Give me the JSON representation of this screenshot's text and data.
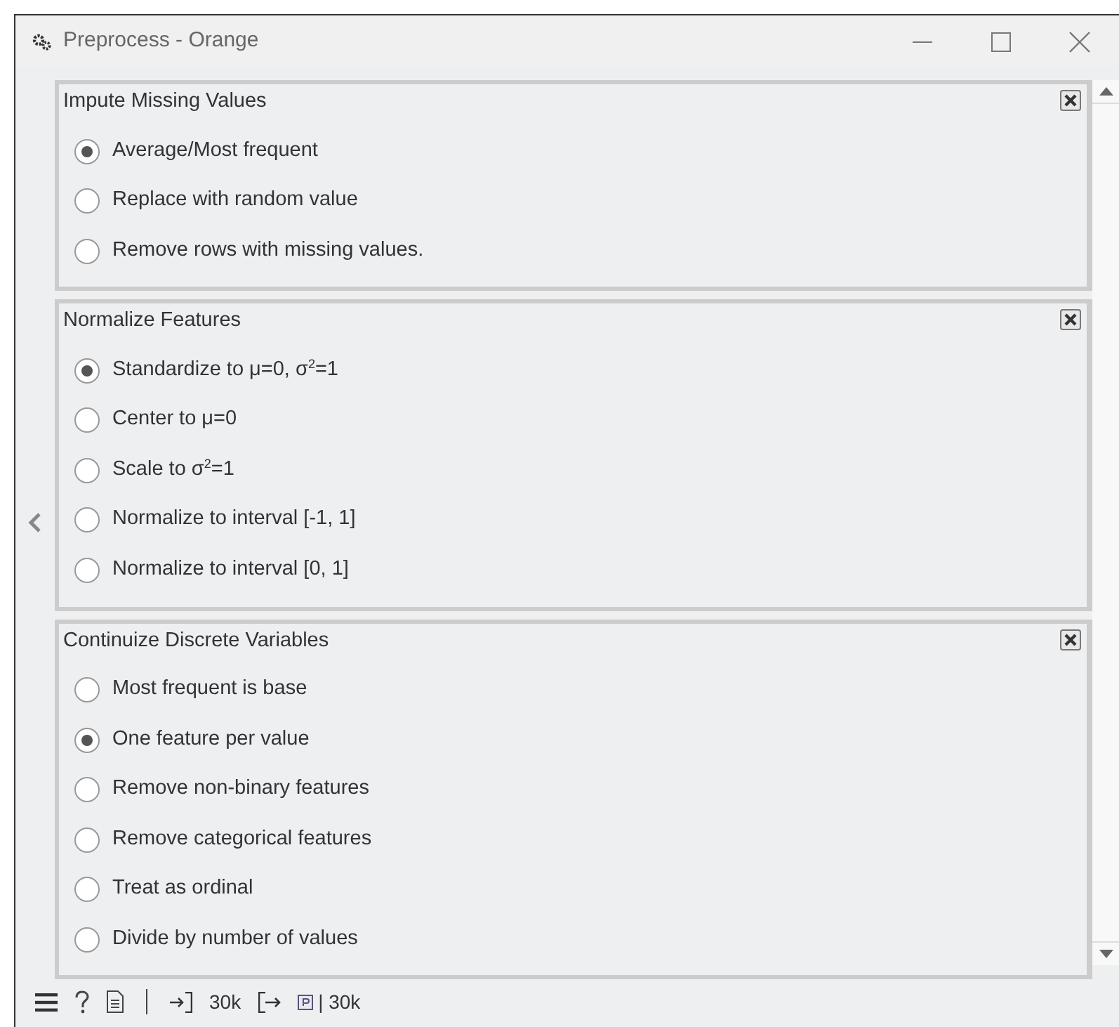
{
  "window": {
    "title": "Preprocess - Orange"
  },
  "panels": [
    {
      "title": "Impute Missing Values",
      "options": [
        {
          "label": "Average/Most frequent",
          "selected": true
        },
        {
          "label": "Replace with random value",
          "selected": false
        },
        {
          "label": "Remove rows with missing values.",
          "selected": false
        }
      ]
    },
    {
      "title": "Normalize Features",
      "options": [
        {
          "label": "Standardize to μ=0, σ$^{2}$=1",
          "selected": true
        },
        {
          "label": "Center to μ=0",
          "selected": false
        },
        {
          "label": "Scale to σ$^{2}$=1",
          "selected": false
        },
        {
          "label": "Normalize to interval [-1, 1]",
          "selected": false
        },
        {
          "label": "Normalize to interval [0, 1]",
          "selected": false
        }
      ]
    },
    {
      "title": "Continuize Discrete Variables",
      "options": [
        {
          "label": "Most frequent is base",
          "selected": false
        },
        {
          "label": "One feature per value",
          "selected": true
        },
        {
          "label": "Remove non-binary features",
          "selected": false
        },
        {
          "label": "Remove categorical features",
          "selected": false
        },
        {
          "label": "Treat as ordinal",
          "selected": false
        },
        {
          "label": "Divide by number of values",
          "selected": false
        }
      ]
    }
  ],
  "status_bar": {
    "input_count": "30k",
    "output_count": "| 30k"
  }
}
